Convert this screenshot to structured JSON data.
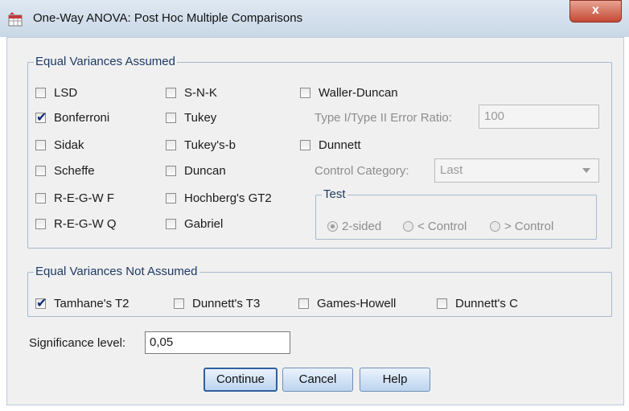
{
  "window": {
    "title": "One-Way ANOVA: Post Hoc Multiple Comparisons",
    "close_label": "x"
  },
  "equal_assumed": {
    "label": "Equal Variances Assumed",
    "col1": [
      {
        "label": "LSD",
        "checked": false
      },
      {
        "label": "Bonferroni",
        "checked": true
      },
      {
        "label": "Sidak",
        "checked": false
      },
      {
        "label": "Scheffe",
        "checked": false
      },
      {
        "label": "R-E-G-W F",
        "checked": false
      },
      {
        "label": "R-E-G-W Q",
        "checked": false
      }
    ],
    "col2": [
      {
        "label": "S-N-K",
        "checked": false
      },
      {
        "label": "Tukey",
        "checked": false
      },
      {
        "label": "Tukey's-b",
        "checked": false
      },
      {
        "label": "Duncan",
        "checked": false
      },
      {
        "label": "Hochberg's GT2",
        "checked": false
      },
      {
        "label": "Gabriel",
        "checked": false
      }
    ],
    "waller_duncan": {
      "label": "Waller-Duncan",
      "checked": false
    },
    "error_ratio": {
      "label": "Type I/Type II Error Ratio:",
      "value": "100"
    },
    "dunnett": {
      "label": "Dunnett",
      "checked": false
    },
    "control_category": {
      "label": "Control Category:",
      "value": "Last"
    },
    "test": {
      "label": "Test",
      "options": [
        {
          "label": "2-sided",
          "selected": true
        },
        {
          "label": "< Control",
          "selected": false
        },
        {
          "label": "> Control",
          "selected": false
        }
      ]
    }
  },
  "equal_not_assumed": {
    "label": "Equal Variances Not Assumed",
    "items": [
      {
        "label": "Tamhane's T2",
        "checked": true
      },
      {
        "label": "Dunnett's T3",
        "checked": false
      },
      {
        "label": "Games-Howell",
        "checked": false
      },
      {
        "label": "Dunnett's C",
        "checked": false
      }
    ]
  },
  "significance": {
    "label": "Significance level:",
    "value": "0,05"
  },
  "buttons": {
    "continue": "Continue",
    "cancel": "Cancel",
    "help": "Help"
  }
}
